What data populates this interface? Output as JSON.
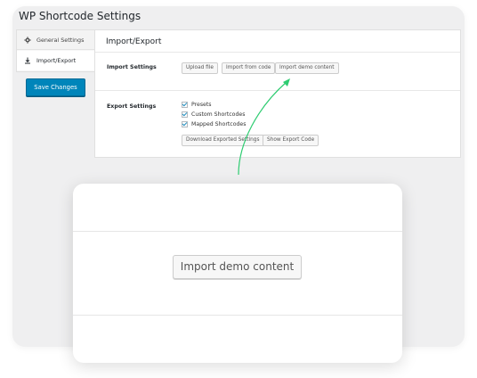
{
  "panel": {
    "title": "WP Shortcode Settings"
  },
  "nav": {
    "items": [
      {
        "label": "General Settings",
        "icon": "gear-icon"
      },
      {
        "label": "Import/Export",
        "icon": "download-icon"
      }
    ]
  },
  "actions": {
    "save_label": "Save Changes"
  },
  "main": {
    "title": "Import/Export",
    "import": {
      "label": "Import Settings",
      "buttons": [
        "Upload file",
        "Import from code",
        "Import demo content"
      ]
    },
    "export": {
      "label": "Export Settings",
      "checkboxes": [
        {
          "label": "Presets",
          "checked": true
        },
        {
          "label": "Custom Shortcodes",
          "checked": true
        },
        {
          "label": "Mapped Shortcodes",
          "checked": true
        }
      ],
      "buttons": [
        "Download Exported Settings",
        "Show Export Code"
      ]
    }
  },
  "zoom": {
    "button_label": "Import demo content"
  },
  "colors": {
    "primary": "#0085ba",
    "arrow": "#2ecc71",
    "panel_bg": "#efeff0"
  }
}
